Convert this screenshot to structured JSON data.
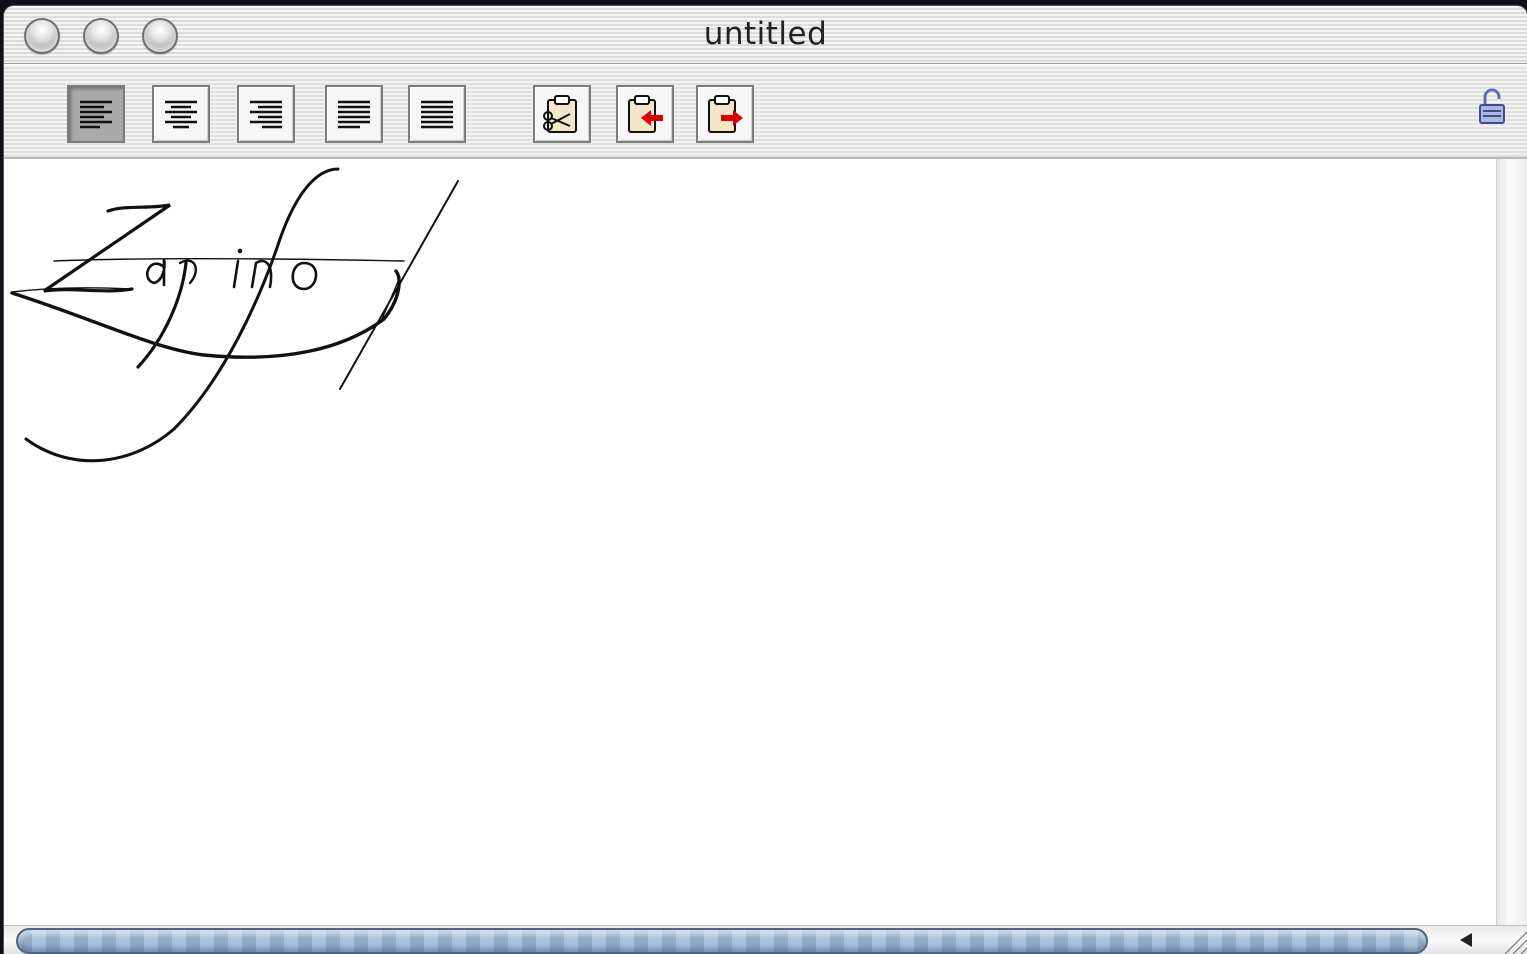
{
  "window": {
    "title": "untitled"
  },
  "toolbar": {
    "buttons": [
      {
        "name": "align-left",
        "pressed": true
      },
      {
        "name": "align-center",
        "pressed": false
      },
      {
        "name": "align-right",
        "pressed": false
      },
      {
        "name": "align-justify",
        "pressed": false
      },
      {
        "name": "align-full",
        "pressed": false
      },
      {
        "name": "cut",
        "icon": "scissors-clipboard-icon"
      },
      {
        "name": "copy",
        "icon": "clipboard-arrow-in-icon"
      },
      {
        "name": "paste",
        "icon": "clipboard-arrow-out-icon"
      }
    ],
    "lock_icon": "lock-icon"
  },
  "document": {
    "sample_text": "Zapfino"
  },
  "colors": {
    "accent_red": "#e00000",
    "scroll_thumb": "#8fa9c6",
    "lock_blue": "#5a6fb0"
  }
}
